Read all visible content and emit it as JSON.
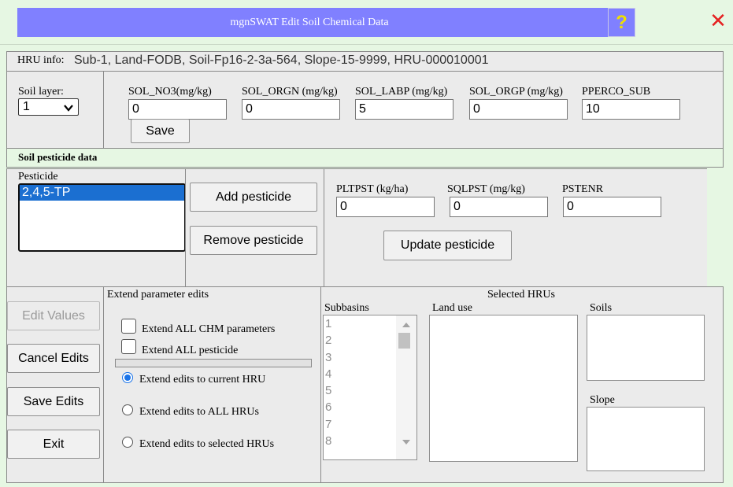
{
  "title": "mgnSWAT Edit Soil Chemical Data",
  "help_glyph": "?",
  "close_glyph": "✕",
  "colors": {
    "title_bar": "#8080ff",
    "accent": "#e6f7e3",
    "close": "#e52222",
    "help": "#f0e000",
    "selected": "#1b6fd1"
  },
  "hru": {
    "label": "HRU info:",
    "value": "Sub-1, Land-FODB, Soil-Fp16-2-3a-564, Slope-15-9999, HRU-000010001"
  },
  "soil_layer": {
    "label": "Soil layer:",
    "value": "1"
  },
  "chem_fields": [
    {
      "label": "SOL_NO3(mg/kg)",
      "value": "0"
    },
    {
      "label": "SOL_ORGN (mg/kg)",
      "value": "0"
    },
    {
      "label": "SOL_LABP (mg/kg)",
      "value": "5"
    },
    {
      "label": "SOL_ORGP (mg/kg)",
      "value": "0"
    },
    {
      "label": "PPERCO_SUB",
      "value": "10"
    }
  ],
  "save_label": "Save",
  "pesticide_header": "Soil pesticide data",
  "pesticide": {
    "list_label": "Pesticide",
    "items": [
      "2,4,5-TP"
    ],
    "add_label": "Add pesticide",
    "remove_label": "Remove pesticide",
    "fields": [
      {
        "label": "PLTPST (kg/ha)",
        "value": "0"
      },
      {
        "label": "SQLPST (mg/kg)",
        "value": "0"
      },
      {
        "label": "PSTENR",
        "value": "0"
      }
    ],
    "update_label": "Update pesticide"
  },
  "actions": {
    "edit_values": "Edit Values",
    "cancel_edits": "Cancel Edits",
    "save_edits": "Save Edits",
    "exit": "Exit"
  },
  "extend": {
    "title": "Extend parameter edits",
    "chm_label": "Extend ALL CHM parameters",
    "pesticide_label": "Extend ALL pesticide",
    "current_hru": "Extend edits to current HRU",
    "all_hrus": "Extend edits to ALL HRUs",
    "selected_hrus": "Extend edits to selected HRUs"
  },
  "selected_hrus": {
    "title": "Selected HRUs",
    "subbasins_label": "Subbasins",
    "subbasins": [
      "1",
      "2",
      "3",
      "4",
      "5",
      "6",
      "7",
      "8"
    ],
    "landuse_label": "Land use",
    "soils_label": "Soils",
    "slope_label": "Slope"
  }
}
